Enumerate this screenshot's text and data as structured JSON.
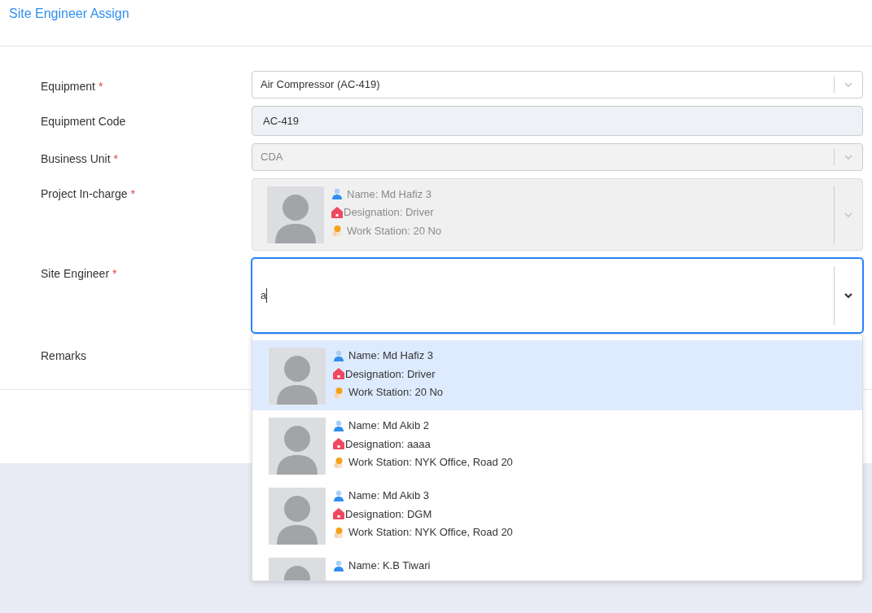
{
  "title": "Site Engineer Assign",
  "fields": [
    {
      "label": "Equipment",
      "required_mark": "*",
      "kind": "select",
      "value": "Air Compressor (AC-419)"
    },
    {
      "label": "Equipment Code",
      "kind": "text",
      "value": "AC-419"
    },
    {
      "label": "Business Unit",
      "required_mark": "*",
      "kind": "select",
      "value": "CDA",
      "disabled": true
    },
    {
      "label": "Project In-charge",
      "required_mark": "*",
      "kind": "person",
      "disabled": true,
      "person": {
        "name": "Name: Md Hafiz 3",
        "designation": "Designation: Driver",
        "station": "Work Station: 20 No"
      }
    },
    {
      "label": "Site Engineer",
      "required_mark": "*",
      "kind": "search",
      "value": "a",
      "focused": true
    },
    {
      "label": "Remarks",
      "kind": "remarks"
    }
  ],
  "options": [
    {
      "name": "Name: Md Hafiz 3",
      "designation": "Designation: Driver",
      "station": "Work Station: 20 No",
      "selected": true
    },
    {
      "name": "Name: Md Akib 2",
      "designation": "Designation: aaaa",
      "station": "Work Station: NYK Office, Road 20",
      "selected": false
    },
    {
      "name": "Name: Md Akib 3",
      "designation": "Designation: DGM",
      "station": "Work Station: NYK Office, Road 20",
      "selected": false
    },
    {
      "name": "Name: K.B Tiwari",
      "selected": false
    }
  ]
}
